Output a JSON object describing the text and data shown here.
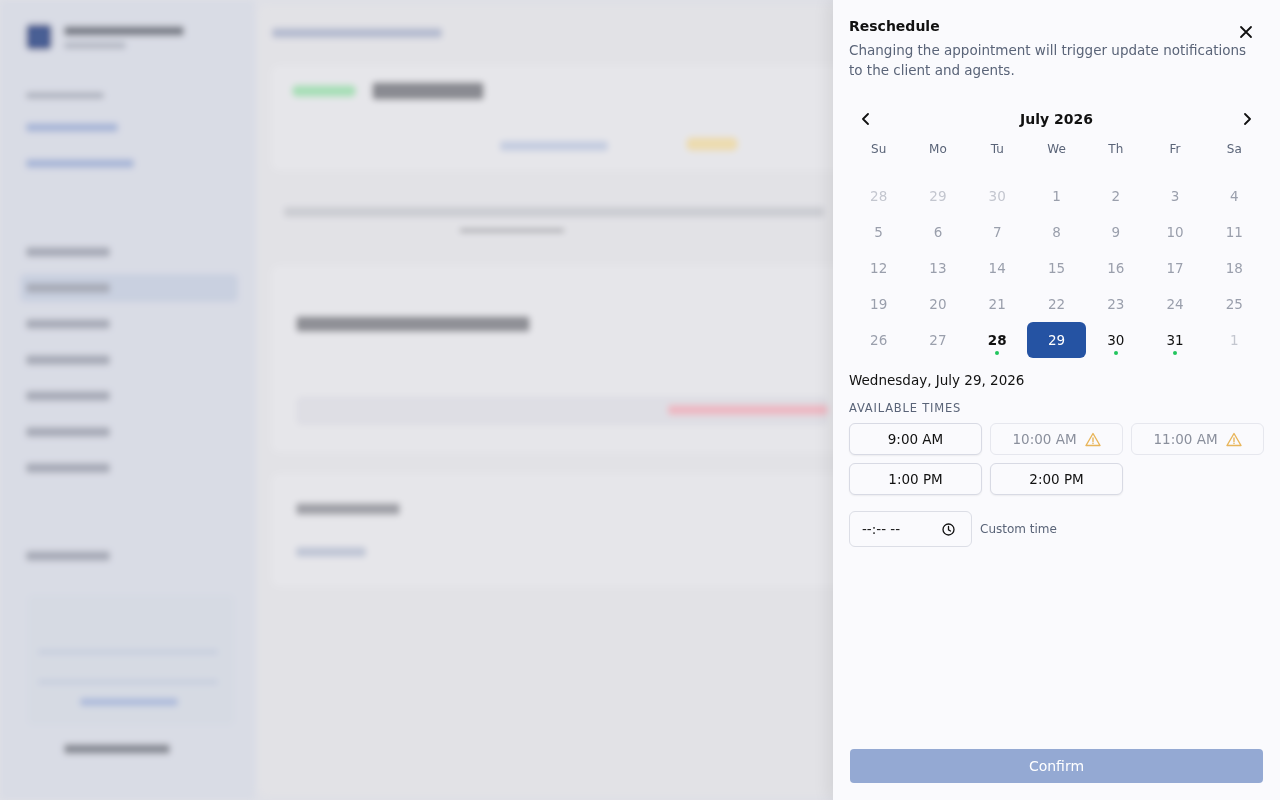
{
  "panel": {
    "title": "Reschedule",
    "description": "Changing the appointment will trigger update notifications to the client and agents."
  },
  "calendar": {
    "month": "July 2026",
    "weekdays": [
      "Su",
      "Mo",
      "Tu",
      "We",
      "Th",
      "Fr",
      "Sa"
    ],
    "days": [
      {
        "label": "28",
        "outside": true,
        "available": false,
        "today": false,
        "selected": false
      },
      {
        "label": "29",
        "outside": true,
        "available": false,
        "today": false,
        "selected": false
      },
      {
        "label": "30",
        "outside": true,
        "available": false,
        "today": false,
        "selected": false
      },
      {
        "label": "1",
        "outside": false,
        "available": false,
        "today": false,
        "selected": false
      },
      {
        "label": "2",
        "outside": false,
        "available": false,
        "today": false,
        "selected": false
      },
      {
        "label": "3",
        "outside": false,
        "available": false,
        "today": false,
        "selected": false
      },
      {
        "label": "4",
        "outside": false,
        "available": false,
        "today": false,
        "selected": false
      },
      {
        "label": "5",
        "outside": false,
        "available": false,
        "today": false,
        "selected": false
      },
      {
        "label": "6",
        "outside": false,
        "available": false,
        "today": false,
        "selected": false
      },
      {
        "label": "7",
        "outside": false,
        "available": false,
        "today": false,
        "selected": false
      },
      {
        "label": "8",
        "outside": false,
        "available": false,
        "today": false,
        "selected": false
      },
      {
        "label": "9",
        "outside": false,
        "available": false,
        "today": false,
        "selected": false
      },
      {
        "label": "10",
        "outside": false,
        "available": false,
        "today": false,
        "selected": false
      },
      {
        "label": "11",
        "outside": false,
        "available": false,
        "today": false,
        "selected": false
      },
      {
        "label": "12",
        "outside": false,
        "available": false,
        "today": false,
        "selected": false
      },
      {
        "label": "13",
        "outside": false,
        "available": false,
        "today": false,
        "selected": false
      },
      {
        "label": "14",
        "outside": false,
        "available": false,
        "today": false,
        "selected": false
      },
      {
        "label": "15",
        "outside": false,
        "available": false,
        "today": false,
        "selected": false
      },
      {
        "label": "16",
        "outside": false,
        "available": false,
        "today": false,
        "selected": false
      },
      {
        "label": "17",
        "outside": false,
        "available": false,
        "today": false,
        "selected": false
      },
      {
        "label": "18",
        "outside": false,
        "available": false,
        "today": false,
        "selected": false
      },
      {
        "label": "19",
        "outside": false,
        "available": false,
        "today": false,
        "selected": false
      },
      {
        "label": "20",
        "outside": false,
        "available": false,
        "today": false,
        "selected": false
      },
      {
        "label": "21",
        "outside": false,
        "available": false,
        "today": false,
        "selected": false
      },
      {
        "label": "22",
        "outside": false,
        "available": false,
        "today": false,
        "selected": false
      },
      {
        "label": "23",
        "outside": false,
        "available": false,
        "today": false,
        "selected": false
      },
      {
        "label": "24",
        "outside": false,
        "available": false,
        "today": false,
        "selected": false
      },
      {
        "label": "25",
        "outside": false,
        "available": false,
        "today": false,
        "selected": false
      },
      {
        "label": "26",
        "outside": false,
        "available": false,
        "today": false,
        "selected": false
      },
      {
        "label": "27",
        "outside": false,
        "available": false,
        "today": false,
        "selected": false
      },
      {
        "label": "28",
        "outside": false,
        "available": true,
        "today": true,
        "selected": false
      },
      {
        "label": "29",
        "outside": false,
        "available": true,
        "today": false,
        "selected": true
      },
      {
        "label": "30",
        "outside": false,
        "available": true,
        "today": false,
        "selected": false
      },
      {
        "label": "31",
        "outside": false,
        "available": true,
        "today": false,
        "selected": false
      },
      {
        "label": "1",
        "outside": true,
        "available": false,
        "today": false,
        "selected": false
      }
    ]
  },
  "selected_date": "Wednesday, July 29, 2026",
  "times_heading": "AVAILABLE TIMES",
  "times": [
    {
      "label": "9:00 AM",
      "conflict": false,
      "selected": false
    },
    {
      "label": "10:00 AM",
      "conflict": true,
      "selected": false
    },
    {
      "label": "11:00 AM",
      "conflict": true,
      "selected": false
    },
    {
      "label": "1:00 PM",
      "conflict": false,
      "selected": false
    },
    {
      "label": "2:00 PM",
      "conflict": false,
      "selected": false
    }
  ],
  "custom_time": {
    "placeholder": "--:-- --",
    "label": "Custom time"
  },
  "confirm": {
    "label": "Confirm",
    "disabled": true
  }
}
